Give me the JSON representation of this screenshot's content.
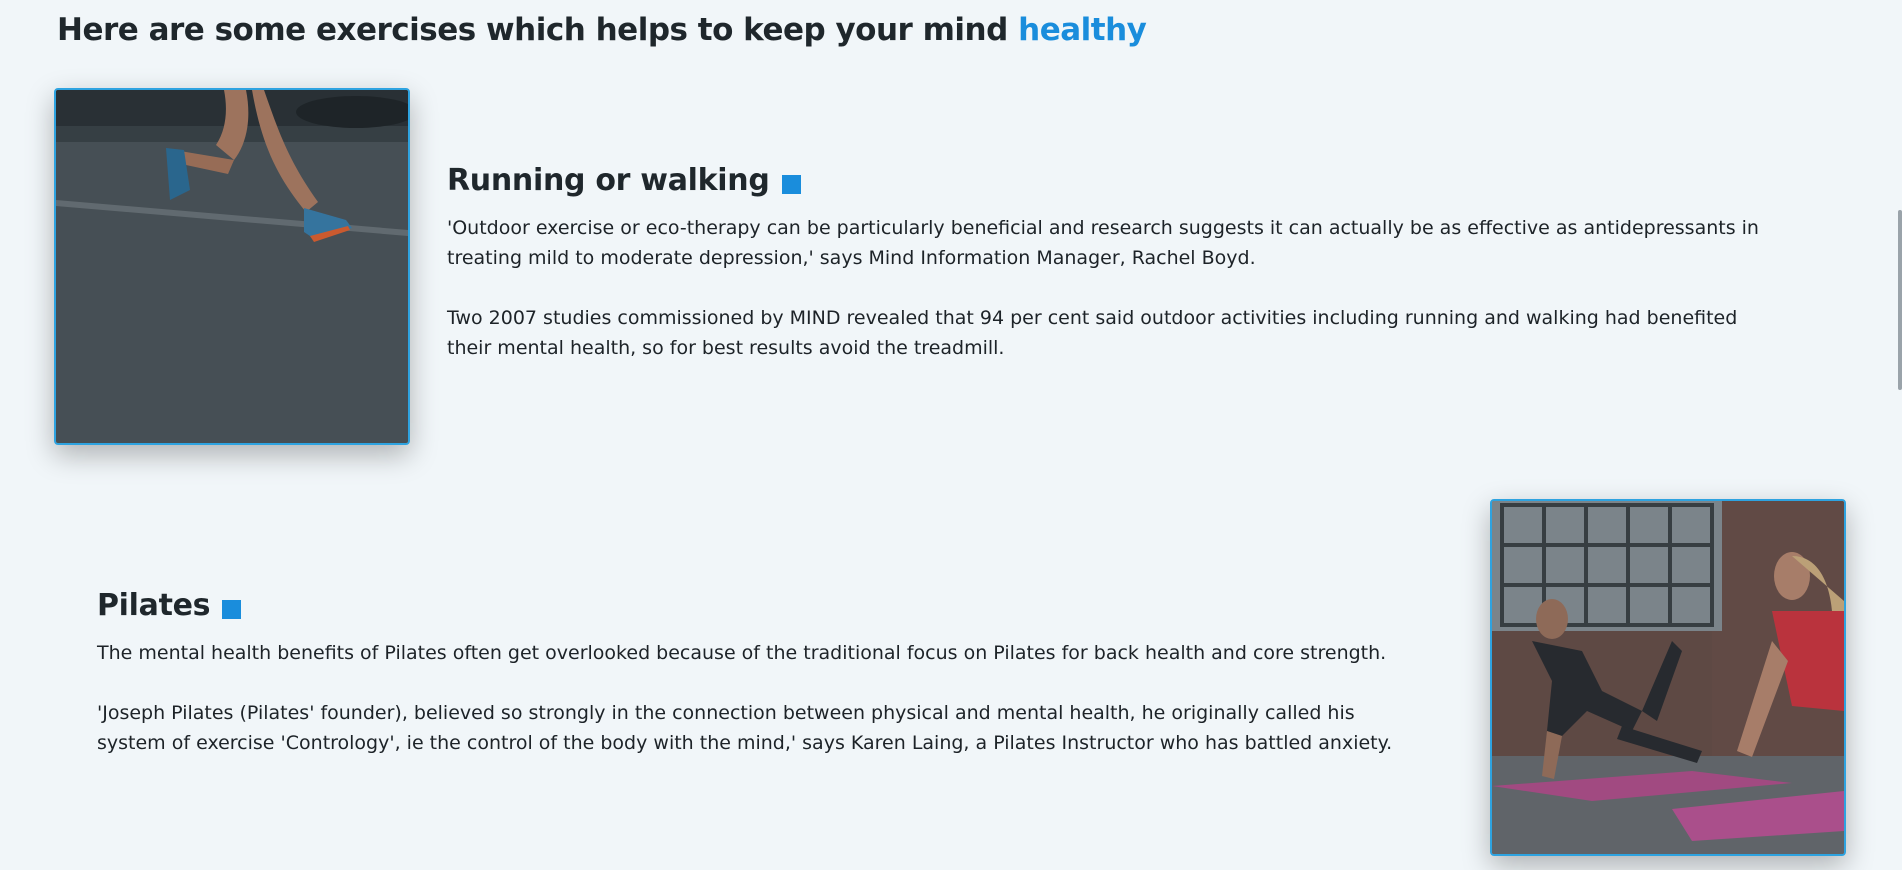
{
  "heading": {
    "text": "Here are some exercises which helps to keep your mind",
    "accent": "healthy"
  },
  "colors": {
    "accent": "#1a8ddc",
    "background": "#f1f6f9",
    "photo_border": "#2ea3e0"
  },
  "sections": [
    {
      "title": "Running or walking",
      "image": "runner-photo",
      "paragraphs": [
        {
          "line1": "'Outdoor exercise or eco-therapy can be particularly beneficial and research suggests it can actually be as effective as antidepressants in",
          "line2": "treating mild to moderate depression,' says Mind Information Manager, Rachel Boyd."
        },
        {
          "line1": "Two 2007 studies commissioned by MIND revealed that 94 per cent said outdoor activities including running and walking had benefited",
          "line2": "their mental health, so for best results avoid the treadmill."
        }
      ]
    },
    {
      "title": "Pilates",
      "image": "pilates-photo",
      "paragraphs": [
        {
          "line1": "The mental health benefits of Pilates often get overlooked because of the traditional focus on Pilates for back health and core strength."
        },
        {
          "line1": "'Joseph Pilates (Pilates' founder), believed so strongly in the connection between physical and mental health, he originally called his",
          "line2": "system of exercise 'Contrology', ie the control of the body with the mind,' says Karen Laing, a Pilates Instructor who has battled anxiety."
        }
      ]
    }
  ]
}
